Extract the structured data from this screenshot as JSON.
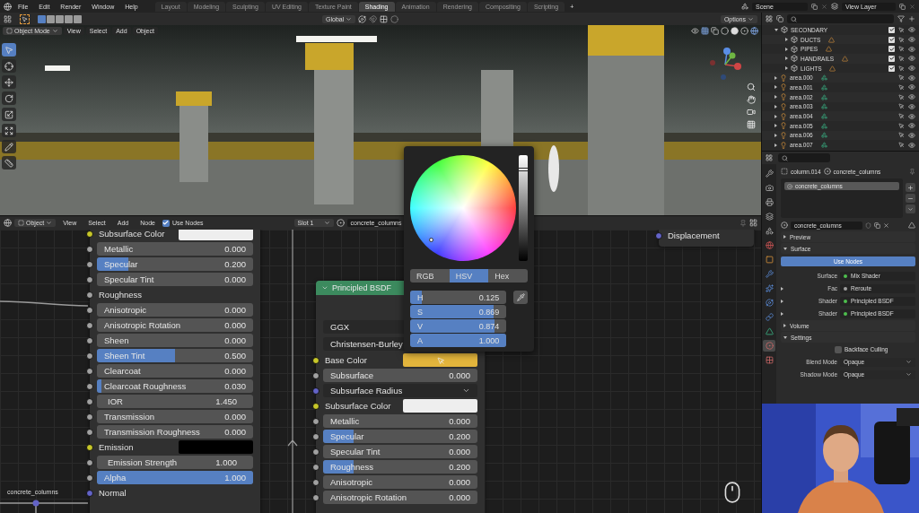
{
  "menu": [
    "File",
    "Edit",
    "Render",
    "Window",
    "Help"
  ],
  "workspaces": [
    {
      "label": "Layout",
      "selected": false
    },
    {
      "label": "Modeling",
      "selected": false
    },
    {
      "label": "Sculpting",
      "selected": false
    },
    {
      "label": "UV Editing",
      "selected": false
    },
    {
      "label": "Texture Paint",
      "selected": false
    },
    {
      "label": "Shading",
      "selected": true
    },
    {
      "label": "Animation",
      "selected": false
    },
    {
      "label": "Rendering",
      "selected": false
    },
    {
      "label": "Compositing",
      "selected": false
    },
    {
      "label": "Scripting",
      "selected": false
    }
  ],
  "add_workspace": "+",
  "scene": "Scene",
  "view_layer": "View Layer",
  "viewport": {
    "orientation": "Global",
    "options": "Options",
    "mode": "Object Mode",
    "menus": [
      "View",
      "Select",
      "Add",
      "Object"
    ],
    "tools": [
      {
        "kind": "select",
        "selected": true
      },
      {
        "kind": "cursor",
        "selected": false
      },
      {
        "kind": "move",
        "selected": false
      },
      {
        "kind": "rotate",
        "selected": false
      },
      {
        "kind": "scale",
        "selected": false
      },
      {
        "kind": "transform",
        "selected": false
      },
      {
        "kind": "annotate",
        "selected": false
      },
      {
        "kind": "measure",
        "selected": false
      }
    ]
  },
  "node_editor": {
    "mode": "Object",
    "menus": [
      "View",
      "Select",
      "Add",
      "Node"
    ],
    "use_nodes": {
      "label": "Use Nodes",
      "checked": true
    },
    "slot": "Slot 1",
    "material": "concrete_columns",
    "reroute_label": "concrete_columns",
    "nodes": [
      {
        "kind": "inputs",
        "rows": [
          {
            "kind": "color",
            "label": "Subsurface Color",
            "color": "#c7c729",
            "swatch": {
              "color": "#eeeeee"
            }
          },
          {
            "kind": "slider",
            "label": "Metallic",
            "value": "0.000",
            "level": 0,
            "color": "#a1a1a1"
          },
          {
            "kind": "slider",
            "label": "Specular",
            "value": "0.200",
            "level": 0.2,
            "color": "#a1a1a1"
          },
          {
            "kind": "slider",
            "label": "Specular Tint",
            "value": "0.000",
            "level": 0,
            "color": "#a1a1a1"
          },
          {
            "kind": "socket",
            "label": "Roughness",
            "color": "#a1a1a1"
          },
          {
            "kind": "slider",
            "label": "Anisotropic",
            "value": "0.000",
            "level": 0,
            "color": "#a1a1a1"
          },
          {
            "kind": "slider",
            "label": "Anisotropic Rotation",
            "value": "0.000",
            "level": 0,
            "color": "#a1a1a1"
          },
          {
            "kind": "slider",
            "label": "Sheen",
            "value": "0.000",
            "level": 0,
            "color": "#a1a1a1"
          },
          {
            "kind": "slider",
            "label": "Sheen Tint",
            "value": "0.500",
            "level": 0.5,
            "color": "#a1a1a1"
          },
          {
            "kind": "slider",
            "label": "Clearcoat",
            "value": "0.000",
            "level": 0,
            "color": "#a1a1a1"
          },
          {
            "kind": "slider",
            "label": "Clearcoat Roughness",
            "value": "0.030",
            "level": 0.03,
            "color": "#a1a1a1"
          },
          {
            "kind": "number",
            "label": "IOR",
            "value": "1.450",
            "color": "#a1a1a1"
          },
          {
            "kind": "slider",
            "label": "Transmission",
            "value": "0.000",
            "level": 0,
            "color": "#a1a1a1"
          },
          {
            "kind": "slider",
            "label": "Transmission Roughness",
            "value": "0.000",
            "level": 0,
            "color": "#a1a1a1"
          },
          {
            "kind": "color",
            "label": "Emission",
            "color": "#c7c729",
            "swatch": {
              "color": "#000000"
            }
          },
          {
            "kind": "number",
            "label": "Emission Strength",
            "value": "1.000",
            "color": "#a1a1a1"
          },
          {
            "kind": "slider",
            "label": "Alpha",
            "value": "1.000",
            "level": 1,
            "color": "#a1a1a1"
          },
          {
            "kind": "socket",
            "label": "Normal",
            "color": "#6363c7"
          }
        ]
      },
      {
        "kind": "principled",
        "title": "Principled BSDF",
        "rows": [
          {
            "kind": "select",
            "label": "GGX"
          },
          {
            "kind": "select",
            "label": "Christensen-Burley"
          },
          {
            "kind": "color",
            "label": "Base Color",
            "color": "#c7c729",
            "swatch": {
              "color": "#e3b53c"
            }
          },
          {
            "kind": "slider",
            "label": "Subsurface",
            "value": "0.000",
            "level": 0,
            "color": "#a1a1a1"
          },
          {
            "kind": "dropdown",
            "label": "Subsurface Radius",
            "color": "#6363c7"
          },
          {
            "kind": "color",
            "label": "Subsurface Color",
            "color": "#c7c729",
            "swatch": {
              "color": "#eeeeee"
            }
          },
          {
            "kind": "slider",
            "label": "Metallic",
            "value": "0.000",
            "level": 0,
            "color": "#a1a1a1"
          },
          {
            "kind": "slider",
            "label": "Specular",
            "value": "0.200",
            "level": 0.2,
            "color": "#a1a1a1"
          },
          {
            "kind": "slider",
            "label": "Specular Tint",
            "value": "0.000",
            "level": 0,
            "color": "#a1a1a1"
          },
          {
            "kind": "slider",
            "label": "Roughness",
            "value": "0.200",
            "level": 0.2,
            "color": "#a1a1a1"
          },
          {
            "kind": "slider",
            "label": "Anisotropic",
            "value": "0.000",
            "level": 0,
            "color": "#a1a1a1"
          },
          {
            "kind": "slider",
            "label": "Anisotropic Rotation",
            "value": "0.000",
            "level": 0,
            "color": "#a1a1a1"
          }
        ]
      },
      {
        "kind": "output",
        "rows": [
          {
            "kind": "socket",
            "label": "Displacement",
            "color": "#6363c7"
          }
        ]
      }
    ]
  },
  "color_picker": {
    "tabs": [
      {
        "label": "RGB",
        "selected": false
      },
      {
        "label": "HSV",
        "selected": true
      },
      {
        "label": "Hex",
        "selected": false
      }
    ],
    "fields": [
      {
        "label": "H",
        "value": "0.125",
        "level": 0.125
      },
      {
        "label": "S",
        "value": "0.869",
        "level": 0.869
      },
      {
        "label": "V",
        "value": "0.874",
        "level": 0.874
      },
      {
        "label": "A",
        "value": "1.000",
        "level": 1
      }
    ],
    "value_slider": {
      "level": 0.874
    }
  },
  "outliner": {
    "items": [
      {
        "label": "SECONDARY",
        "kind": "collection",
        "expanded": true,
        "checked": true,
        "children": [
          {
            "label": "DUCTS",
            "kind": "collection",
            "expanded": false,
            "checked": true
          },
          {
            "label": "PIPES",
            "kind": "collection",
            "expanded": false,
            "checked": true
          },
          {
            "label": "HANDRAILS",
            "kind": "collection",
            "expanded": false,
            "checked": true
          },
          {
            "label": "LIGHTS",
            "kind": "collection",
            "expanded": false,
            "checked": true
          }
        ]
      },
      {
        "label": "area.000",
        "kind": "light",
        "expanded": false
      },
      {
        "label": "area.001",
        "kind": "light",
        "expanded": false
      },
      {
        "label": "area.002",
        "kind": "light",
        "expanded": false
      },
      {
        "label": "area.003",
        "kind": "light",
        "expanded": false
      },
      {
        "label": "area.004",
        "kind": "light",
        "expanded": false
      },
      {
        "label": "area.005",
        "kind": "light",
        "expanded": false
      },
      {
        "label": "area.006",
        "kind": "light",
        "expanded": false
      },
      {
        "label": "area.007",
        "kind": "light",
        "expanded": false
      }
    ]
  },
  "properties": {
    "tabs": [
      {
        "kind": "tool",
        "selected": false
      },
      {
        "kind": "render",
        "selected": false
      },
      {
        "kind": "output",
        "selected": false
      },
      {
        "kind": "view_layer",
        "selected": false
      },
      {
        "kind": "scene",
        "selected": false
      },
      {
        "kind": "world",
        "selected": false
      },
      {
        "kind": "object",
        "selected": false
      },
      {
        "kind": "modifiers",
        "selected": false
      },
      {
        "kind": "particles",
        "selected": false
      },
      {
        "kind": "physics",
        "selected": false
      },
      {
        "kind": "constraints",
        "selected": false
      },
      {
        "kind": "data",
        "selected": false
      },
      {
        "kind": "material",
        "selected": true
      },
      {
        "kind": "texture",
        "selected": false
      }
    ],
    "object": "column.014",
    "material": "concrete_columns",
    "slots": [
      {
        "label": "concrete_columns",
        "selected": true
      }
    ],
    "material_field": "concrete_columns",
    "panels": [
      {
        "title": "Preview",
        "expanded": false
      },
      {
        "title": "Surface",
        "expanded": true,
        "button": "Use Nodes",
        "props": [
          {
            "kind": "socket",
            "label": "Surface",
            "value": "Mix Shader",
            "color": "#4dbf4d"
          },
          {
            "kind": "socket",
            "label": "Fac",
            "value": "Reroute",
            "color": "#a1a1a1",
            "expanded": false
          },
          {
            "kind": "socket",
            "label": "Shader",
            "value": "Principled BSDF",
            "color": "#4dbf4d",
            "expanded": false
          },
          {
            "kind": "socket",
            "label": "Shader",
            "value": "Principled BSDF",
            "color": "#4dbf4d",
            "expanded": false
          }
        ]
      },
      {
        "title": "Volume",
        "expanded": false
      },
      {
        "title": "Settings",
        "expanded": true,
        "checkbox": {
          "label": "Backface Culling",
          "checked": false
        },
        "props": [
          {
            "kind": "dropdown",
            "label": "Blend Mode",
            "value": "Opaque"
          },
          {
            "kind": "dropdown",
            "label": "Shadow Mode",
            "value": "Opaque"
          }
        ]
      }
    ]
  }
}
